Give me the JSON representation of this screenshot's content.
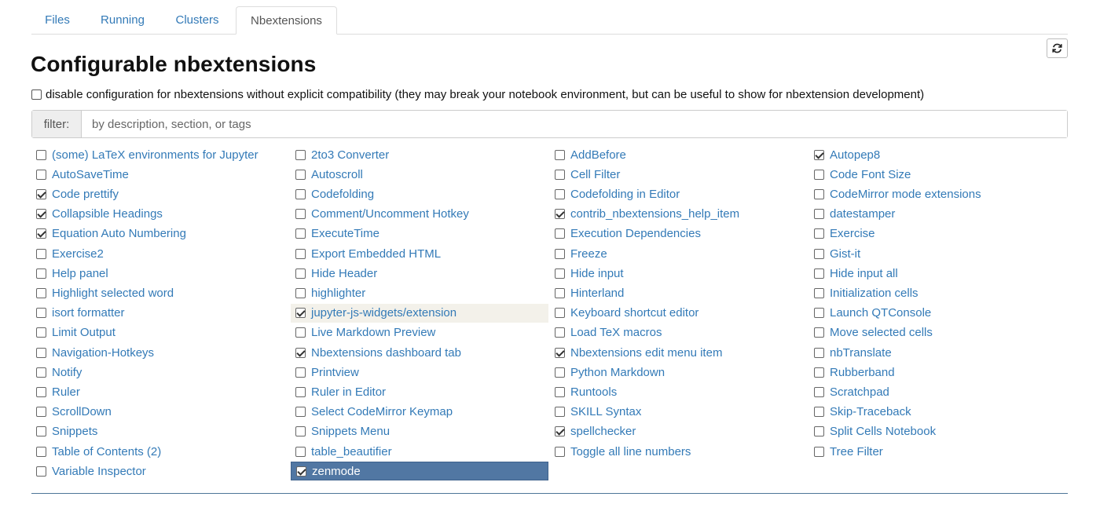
{
  "tabs": [
    "Files",
    "Running",
    "Clusters",
    "Nbextensions"
  ],
  "active_tab": "Nbextensions",
  "title": "Configurable nbextensions",
  "disable_config_label": "disable configuration for nbextensions without explicit compatibility (they may break your notebook environment, but can be useful to show for nbextension development)",
  "filter": {
    "label": "filter:",
    "placeholder": "by description, section, or tags"
  },
  "columns": [
    [
      {
        "label": "(some) LaTeX environments for Jupyter",
        "checked": false
      },
      {
        "label": "AutoSaveTime",
        "checked": false
      },
      {
        "label": "Code prettify",
        "checked": true
      },
      {
        "label": "Collapsible Headings",
        "checked": true
      },
      {
        "label": "Equation Auto Numbering",
        "checked": true
      },
      {
        "label": "Exercise2",
        "checked": false
      },
      {
        "label": "Help panel",
        "checked": false
      },
      {
        "label": "Highlight selected word",
        "checked": false
      },
      {
        "label": "isort formatter",
        "checked": false
      },
      {
        "label": "Limit Output",
        "checked": false
      },
      {
        "label": "Navigation-Hotkeys",
        "checked": false
      },
      {
        "label": "Notify",
        "checked": false
      },
      {
        "label": "Ruler",
        "checked": false
      },
      {
        "label": "ScrollDown",
        "checked": false
      },
      {
        "label": "Snippets",
        "checked": false
      },
      {
        "label": "Table of Contents (2)",
        "checked": false
      },
      {
        "label": "Variable Inspector",
        "checked": false
      }
    ],
    [
      {
        "label": "2to3 Converter",
        "checked": false
      },
      {
        "label": "Autoscroll",
        "checked": false
      },
      {
        "label": "Codefolding",
        "checked": false
      },
      {
        "label": "Comment/Uncomment Hotkey",
        "checked": false
      },
      {
        "label": "ExecuteTime",
        "checked": false
      },
      {
        "label": "Export Embedded HTML",
        "checked": false
      },
      {
        "label": "Hide Header",
        "checked": false
      },
      {
        "label": "highlighter",
        "checked": false
      },
      {
        "label": "jupyter-js-widgets/extension",
        "checked": true,
        "state": "hover"
      },
      {
        "label": "Live Markdown Preview",
        "checked": false
      },
      {
        "label": "Nbextensions dashboard tab",
        "checked": true
      },
      {
        "label": "Printview",
        "checked": false
      },
      {
        "label": "Ruler in Editor",
        "checked": false
      },
      {
        "label": "Select CodeMirror Keymap",
        "checked": false
      },
      {
        "label": "Snippets Menu",
        "checked": false
      },
      {
        "label": "table_beautifier",
        "checked": false
      },
      {
        "label": "zenmode",
        "checked": true,
        "state": "selected"
      }
    ],
    [
      {
        "label": "AddBefore",
        "checked": false
      },
      {
        "label": "Cell Filter",
        "checked": false
      },
      {
        "label": "Codefolding in Editor",
        "checked": false
      },
      {
        "label": "contrib_nbextensions_help_item",
        "checked": true
      },
      {
        "label": "Execution Dependencies",
        "checked": false
      },
      {
        "label": "Freeze",
        "checked": false
      },
      {
        "label": "Hide input",
        "checked": false
      },
      {
        "label": "Hinterland",
        "checked": false
      },
      {
        "label": "Keyboard shortcut editor",
        "checked": false
      },
      {
        "label": "Load TeX macros",
        "checked": false
      },
      {
        "label": "Nbextensions edit menu item",
        "checked": true
      },
      {
        "label": "Python Markdown",
        "checked": false
      },
      {
        "label": "Runtools",
        "checked": false
      },
      {
        "label": "SKILL Syntax",
        "checked": false
      },
      {
        "label": "spellchecker",
        "checked": true
      },
      {
        "label": "Toggle all line numbers",
        "checked": false
      }
    ],
    [
      {
        "label": "Autopep8",
        "checked": true
      },
      {
        "label": "Code Font Size",
        "checked": false
      },
      {
        "label": "CodeMirror mode extensions",
        "checked": false
      },
      {
        "label": "datestamper",
        "checked": false
      },
      {
        "label": "Exercise",
        "checked": false
      },
      {
        "label": "Gist-it",
        "checked": false
      },
      {
        "label": "Hide input all",
        "checked": false
      },
      {
        "label": "Initialization cells",
        "checked": false
      },
      {
        "label": "Launch QTConsole",
        "checked": false
      },
      {
        "label": "Move selected cells",
        "checked": false
      },
      {
        "label": "nbTranslate",
        "checked": false
      },
      {
        "label": "Rubberband",
        "checked": false
      },
      {
        "label": "Scratchpad",
        "checked": false
      },
      {
        "label": "Skip-Traceback",
        "checked": false
      },
      {
        "label": "Split Cells Notebook",
        "checked": false
      },
      {
        "label": "Tree Filter",
        "checked": false
      }
    ]
  ],
  "colors": {
    "link": "#337ab7",
    "selected_bg": "#5177a3",
    "hover_bg": "#f3f1ea"
  }
}
